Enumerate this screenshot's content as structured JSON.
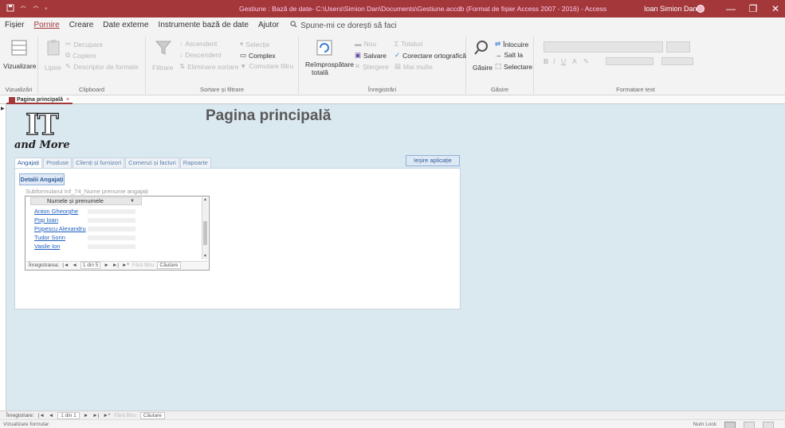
{
  "titlebar": {
    "title": "Gestiune : Bază de date- C:\\Users\\Simion Dan\\Documents\\Gestiune.accdb (Format de fișier Access 2007 - 2016) - Access",
    "user": "Ioan Simion Dan",
    "minimize": "—",
    "restore": "❐",
    "close": "✕"
  },
  "menu": {
    "tabs": [
      "Fișier",
      "Pornire",
      "Creare",
      "Date externe",
      "Instrumente bază de date",
      "Ajutor"
    ],
    "active": "Pornire",
    "tellme": "Spune-mi ce dorești să faci"
  },
  "ribbon": {
    "views": {
      "label": "Vizualizări",
      "button": "Vizualizare"
    },
    "clipboard": {
      "label": "Clipboard",
      "cut": "Decupare",
      "copy": "Copiere",
      "paste": "Lipire",
      "painter": "Descriptor de formate"
    },
    "sort": {
      "label": "Sortare și filtrare",
      "filter": "Filtrare",
      "asc": "Ascendent",
      "desc": "Descendent",
      "remove": "Eliminare sortare",
      "selection": "Selecție",
      "advanced": "Complex",
      "toggle": "Comutare filtru"
    },
    "records": {
      "label": "Înregistrări",
      "refresh": "Reîmprospătare",
      "refresh2": "totală",
      "new": "Nou",
      "save": "Salvare",
      "delete": "Ștergere",
      "totals": "Totaluri",
      "spelling": "Corectare ortografică",
      "more": "Mai multe"
    },
    "find": {
      "label": "Găsire",
      "find": "Găsire",
      "replace": "Înlocuire",
      "goto": "Salt la",
      "select": "Selectare"
    },
    "text": {
      "label": "Formatare text"
    }
  },
  "doctab": {
    "label": "Pagina principală",
    "close": "×"
  },
  "form": {
    "logo_it": "IT",
    "logo_more": "and More",
    "title": "Pagina principală",
    "exit_button": "Ieșire aplicație",
    "tabs": [
      "Angajați",
      "Produse",
      "Clienți și furnizori",
      "Comenzi și facturi",
      "Rapoarte"
    ],
    "active_tab": "Angajați",
    "detail_button": "Detalii Angajați",
    "subform_label": "Subformularul Inf_74_Nume prenume angajați",
    "subform_header": "Numele și prenumele",
    "employees": [
      "Anton Gheorghe",
      "Pop Ioan",
      "Popescu Alexandru",
      "Tudor Sorin",
      "Vasile Ion"
    ],
    "subform_nav": {
      "label": "Înregistrarea:",
      "position": "1 din 5",
      "filter": "Fără filtru",
      "search": "Căutare"
    }
  },
  "recnav": {
    "label": "Înregistrare:",
    "position": "1 din 1",
    "filter": "Fără filtru",
    "search": "Căutare"
  },
  "status": {
    "left": "Vizualizare formular",
    "numlock": "Num Lock"
  }
}
